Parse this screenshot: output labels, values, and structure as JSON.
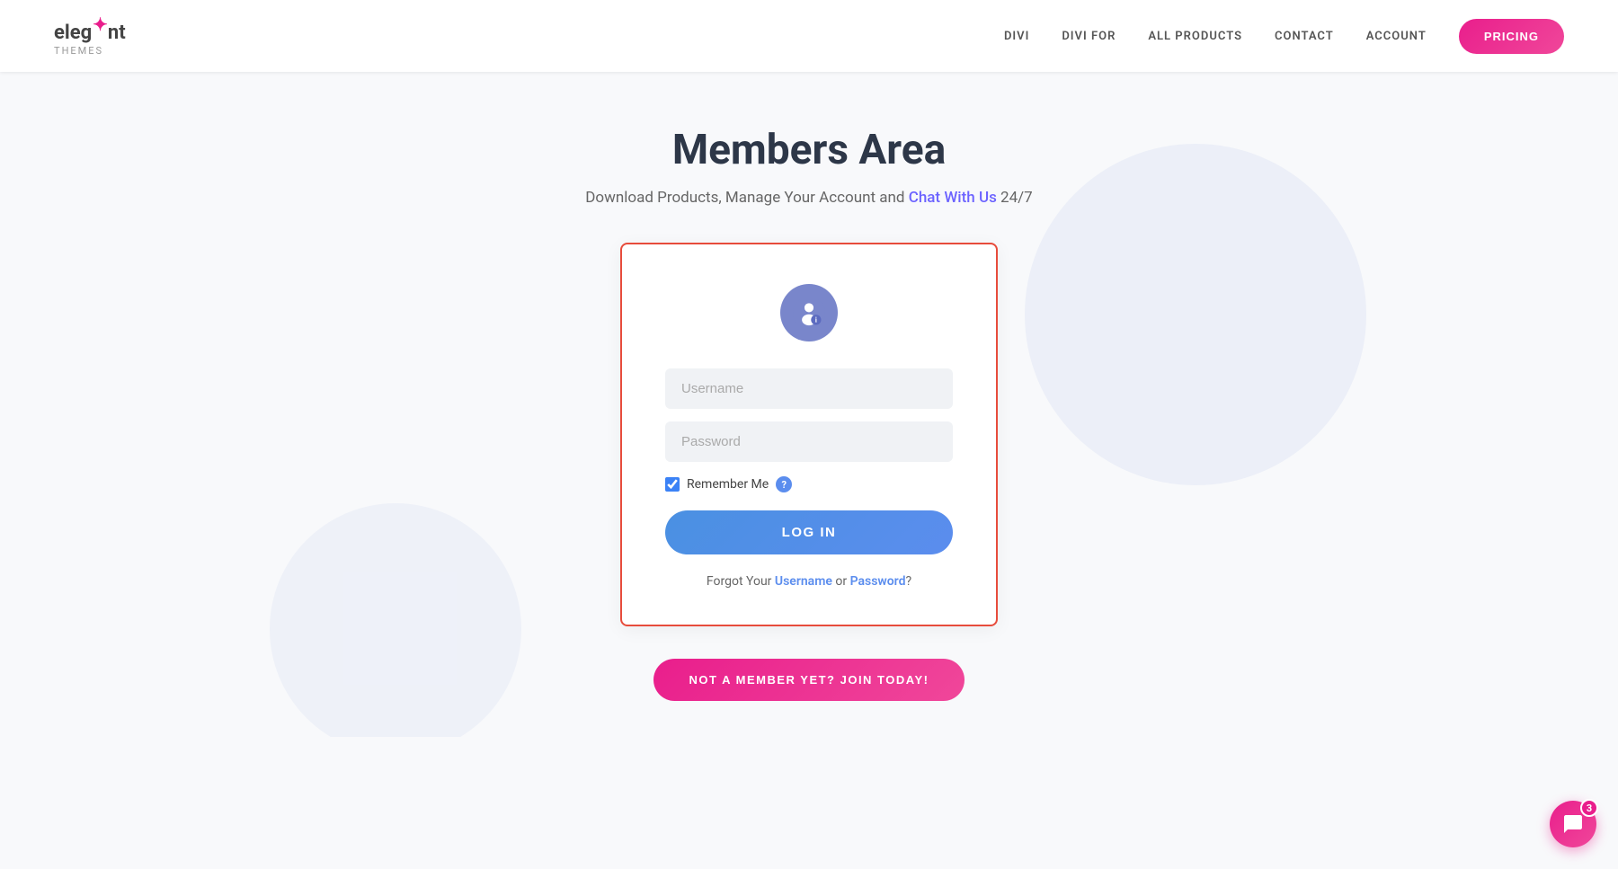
{
  "header": {
    "logo": {
      "name": "elegant",
      "star": "✦",
      "sub": "themes"
    },
    "nav": {
      "items": [
        {
          "id": "divi",
          "label": "DIVI"
        },
        {
          "id": "divi-for",
          "label": "DIVI FOR"
        },
        {
          "id": "all-products",
          "label": "ALL PRODUCTS"
        },
        {
          "id": "contact",
          "label": "CONTACT"
        },
        {
          "id": "account",
          "label": "ACCOUNT"
        }
      ],
      "pricing_label": "PRICING"
    }
  },
  "main": {
    "title": "Members Area",
    "subtitle_text": "Download Products, Manage Your Account and",
    "subtitle_link": "Chat With Us",
    "subtitle_suffix": " 24/7"
  },
  "login_form": {
    "username_placeholder": "Username",
    "password_placeholder": "Password",
    "remember_label": "Remember Me",
    "login_button": "LOG IN",
    "forgot_prefix": "Forgot Your ",
    "forgot_username": "Username",
    "forgot_middle": " or ",
    "forgot_password": "Password",
    "forgot_suffix": "?"
  },
  "join": {
    "button_label": "NOT A MEMBER YET? JOIN TODAY!"
  },
  "chat": {
    "badge": "3"
  },
  "colors": {
    "accent_pink": "#e91e8c",
    "accent_blue": "#5b8dee",
    "card_border": "#e74c3c",
    "user_icon_bg": "#7986cb",
    "link_purple": "#6c63ff"
  }
}
